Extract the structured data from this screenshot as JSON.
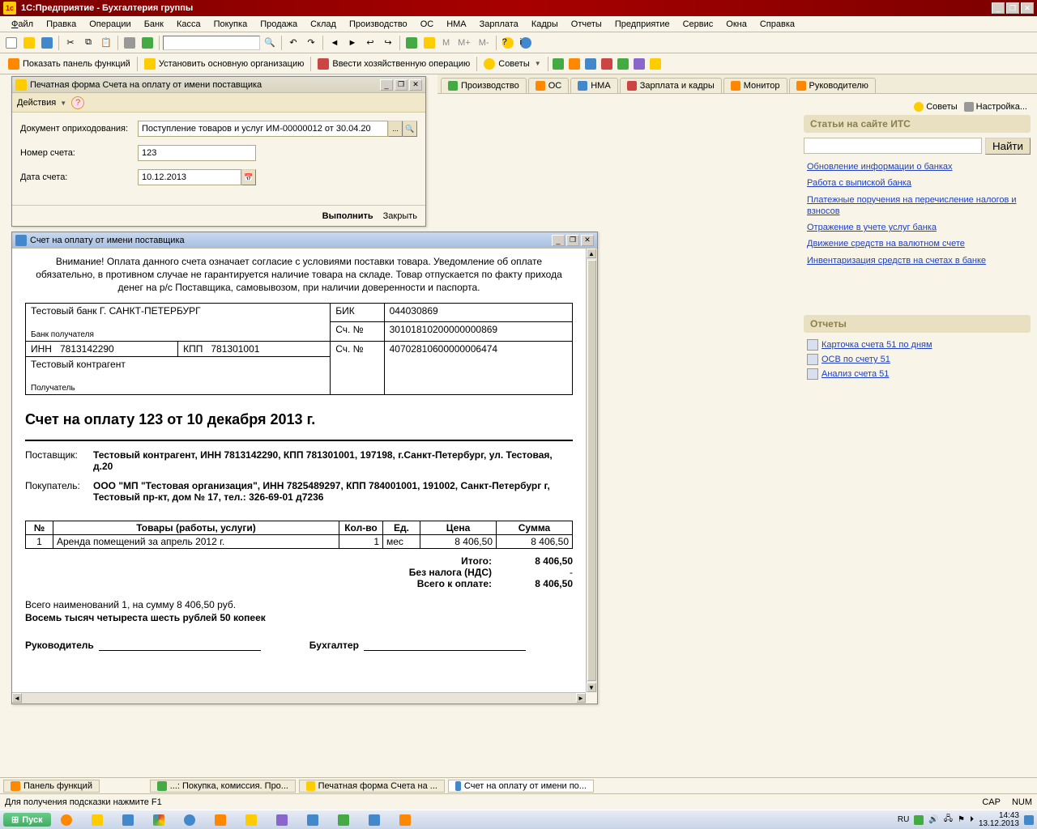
{
  "app": {
    "title": "1С:Предприятие - Бухгалтерия группы",
    "logo": "1c"
  },
  "menu": [
    "Файл",
    "Правка",
    "Операции",
    "Банк",
    "Касса",
    "Покупка",
    "Продажа",
    "Склад",
    "Производство",
    "ОС",
    "НМА",
    "Зарплата",
    "Кадры",
    "Отчеты",
    "Предприятие",
    "Сервис",
    "Окна",
    "Справка"
  ],
  "toolbar2": {
    "show_panel": "Показать панель функций",
    "set_org": "Установить основную организацию",
    "manual_op": "Ввести хозяйственную операцию",
    "tips": "Советы"
  },
  "tabs": [
    "Производство",
    "ОС",
    "НМА",
    "Зарплата и кадры",
    "Монитор",
    "Руководителю"
  ],
  "right_panel": {
    "tips": "Советы",
    "settings": "Настройка...",
    "section_articles": "Статьи на сайте ИТС",
    "find": "Найти",
    "links": [
      "Обновление информации о банках",
      "Работа с выпиской банка",
      "Платежные поручения на перечисление налогов и взносов",
      "Отражение в учете услуг банка",
      "Движение средств на валютном счете",
      "Инвентаризация средств на счетах в банке"
    ],
    "section_reports": "Отчеты",
    "reports": [
      "Карточка счета 51 по дням",
      "ОСВ по счету 51",
      "Анализ счета 51"
    ]
  },
  "form_window": {
    "title": "Печатная форма  Счета на оплату от имени поставщика",
    "actions": "Действия",
    "doc_label": "Документ оприходования:",
    "doc_value": "Поступление товаров и услуг ИМ-00000012 от 30.04.20",
    "num_label": "Номер счета:",
    "num_value": "123",
    "date_label": "Дата счета:",
    "date_value": "10.12.2013",
    "execute": "Выполнить",
    "close": "Закрыть"
  },
  "print_window": {
    "title": "Счет на оплату от имени поставщика",
    "warning": "Внимание! Оплата данного счета означает согласие с условиями поставки товара. Уведомление об оплате обязательно, в противном случае не гарантируется наличие товара на складе. Товар отпускается по факту прихода денег на р/с Поставщика, самовывозом, при наличии доверенности и паспорта.",
    "bank_name": "Тестовый банк Г. САНКТ-ПЕТЕРБУРГ",
    "bank_receiver": "Банк получателя",
    "bik_label": "БИК",
    "bik": "044030869",
    "acc_label": "Сч. №",
    "bank_acc": "30101810200000000869",
    "inn_label": "ИНН",
    "inn": "7813142290",
    "kpp_label": "КПП",
    "kpp": "781301001",
    "payee_acc": "40702810600000006474",
    "counterparty": "Тестовый контрагент",
    "receiver": "Получатель",
    "invoice_title": "Счет на оплату 123 от 10 декабря 2013 г.",
    "supplier_label": "Поставщик:",
    "supplier": "Тестовый контрагент, ИНН 7813142290, КПП 781301001, 197198, г.Санкт-Петербург, ул. Тестовая, д.20",
    "buyer_label": "Покупатель:",
    "buyer": "ООО \"МП \"Тестовая организация\", ИНН 7825489297, КПП 784001001, 191002, Санкт-Петербург г, Тестовый пр-кт, дом № 17, тел.: 326-69-01 д7236",
    "columns": [
      "№",
      "Товары (работы, услуги)",
      "Кол-во",
      "Ед.",
      "Цена",
      "Сумма"
    ],
    "rows": [
      {
        "n": "1",
        "name": "Аренда помещений за апрель 2012 г.",
        "qty": "1",
        "unit": "мес",
        "price": "8 406,50",
        "sum": "8 406,50"
      }
    ],
    "total_label": "Итого:",
    "total": "8 406,50",
    "vat_label": "Без налога (НДС)",
    "vat": "-",
    "grand_label": "Всего к оплате:",
    "grand": "8 406,50",
    "items_summary": "Всего наименований 1, на сумму 8 406,50 руб.",
    "amount_words": "Восемь тысяч четыреста шесть рублей 50 копеек",
    "director": "Руководитель",
    "accountant": "Бухгалтер"
  },
  "task_1c": {
    "panel": "Панель функций",
    "t1": "...: Покупка, комиссия. Про...",
    "t2": "Печатная форма  Счета на ...",
    "t3": "Счет на оплату от имени по..."
  },
  "statusbar": {
    "hint": "Для получения подсказки нажмите F1",
    "cap": "CAP",
    "num": "NUM"
  },
  "win_taskbar": {
    "start": "Пуск",
    "lang": "RU",
    "time": "14:43",
    "date": "13.12.2013"
  }
}
